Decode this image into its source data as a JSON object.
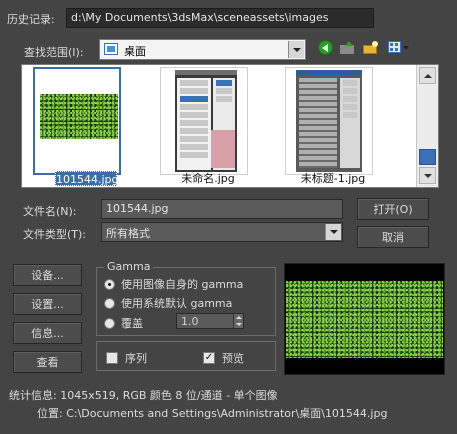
{
  "history": {
    "label": "历史记录:",
    "path": "d:\\My Documents\\3dsMax\\sceneassets\\images"
  },
  "lookin": {
    "label": "查找范围(I):",
    "value": "桌面"
  },
  "toolbar_icons": [
    "back-icon",
    "up-folder-icon",
    "new-folder-icon",
    "view-menu-icon"
  ],
  "thumbnails": [
    {
      "caption": "101544.jpg",
      "selected": true
    },
    {
      "caption": "未命名.jpg",
      "selected": false
    },
    {
      "caption": "未标题-1.jpg",
      "selected": false
    }
  ],
  "filename": {
    "label": "文件名(N):",
    "value": "101544.jpg"
  },
  "filetype": {
    "label": "文件类型(T):",
    "value": "所有格式"
  },
  "buttons": {
    "open": "打开(O)",
    "cancel": "取消",
    "setup": "设备...",
    "settings": "设置...",
    "info": "信息...",
    "view": "查看"
  },
  "gamma": {
    "title": "Gamma",
    "options": [
      "使用图像自身的 gamma",
      "使用系统默认 gamma",
      "覆盖"
    ],
    "selected_index": 0,
    "override_value": "1.0"
  },
  "sequence": {
    "label": "序列",
    "checked": false
  },
  "preview": {
    "label": "预览",
    "checked": true
  },
  "stats": {
    "label": "统计信息:",
    "value": "1045x519, RGB 颜色 8 位/通道 - 单个图像"
  },
  "location": {
    "label": "位置:",
    "value": "C:\\Documents and Settings\\Administrator\\桌面\\101544.jpg"
  },
  "colors": {
    "window_bg": "#444444",
    "selection": "#3a6ea5",
    "field_bg": "#2b2b2b"
  }
}
